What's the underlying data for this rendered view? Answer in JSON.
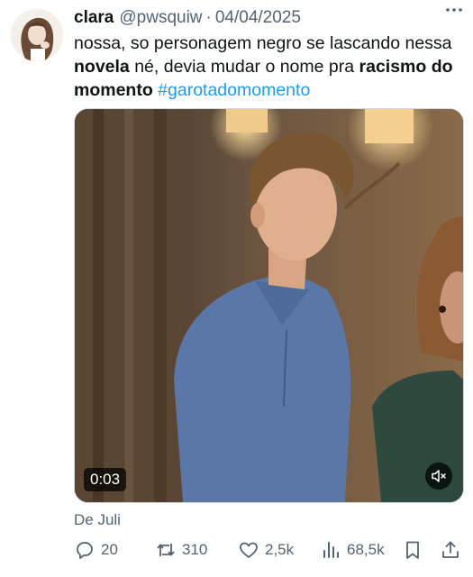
{
  "tweet": {
    "display_name": "clara",
    "handle": "@pwsquiw",
    "separator": "·",
    "date": "04/04/2025",
    "text_parts": {
      "p1": "nossa, so personagem negro se lascando nessa ",
      "p2_bold": "novela",
      "p3": " né, devia mudar o nome pra ",
      "p4_bold": "racismo do momento",
      "p5": " ",
      "hashtag": "#garotadomomento"
    }
  },
  "media": {
    "duration": "0:03",
    "mute_icon": "speaker-muted-icon"
  },
  "caption": "De Juli",
  "actions": {
    "replies": "20",
    "reposts": "310",
    "likes": "2,5k",
    "views": "68,5k"
  },
  "colors": {
    "accent": "#1d9bf0",
    "secondary_text": "#536471",
    "primary_text": "#0f1419"
  }
}
